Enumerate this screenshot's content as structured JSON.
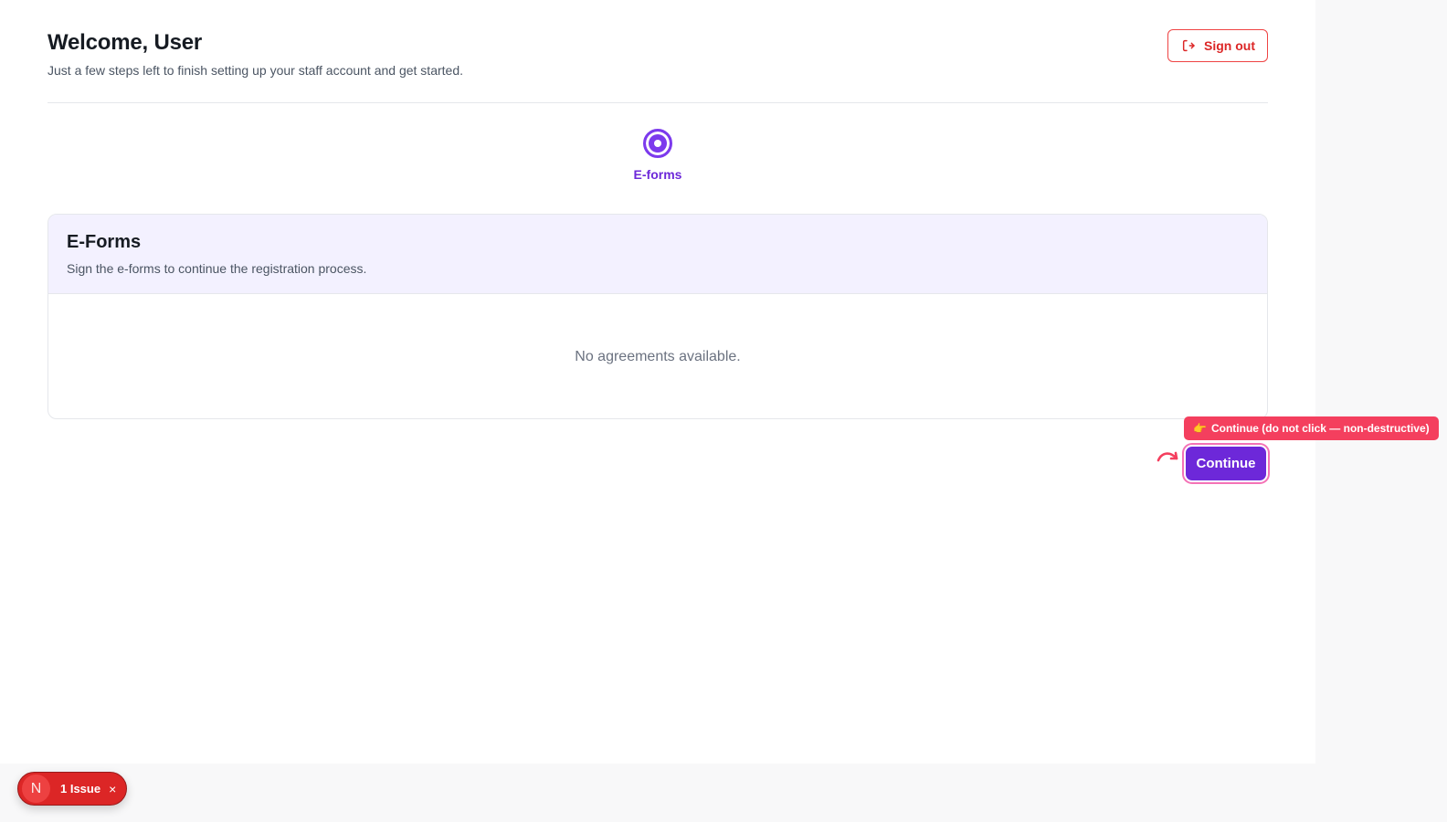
{
  "header": {
    "title": "Welcome, User",
    "subtitle": "Just a few steps left to finish setting up your staff account and get started.",
    "signout_label": "Sign out",
    "signout_icon": "sign-out-icon"
  },
  "stepper": {
    "steps": [
      {
        "label": "E-forms",
        "state": "active"
      }
    ]
  },
  "card": {
    "title": "E-Forms",
    "description": "Sign the e-forms to continue the registration process.",
    "empty_message": "No agreements available."
  },
  "actions": {
    "continue_label": "Continue",
    "hint_emoji": "👉",
    "hint_text": "Continue (do not click — non-destructive)"
  },
  "dev_overlay": {
    "avatar_letter": "N",
    "issues_label": "1 Issue",
    "close_glyph": "×"
  },
  "colors": {
    "primary": "#6d28d9",
    "danger": "#dc2626",
    "hint": "#f43f5e",
    "card_header_bg": "#f3f1ff"
  }
}
